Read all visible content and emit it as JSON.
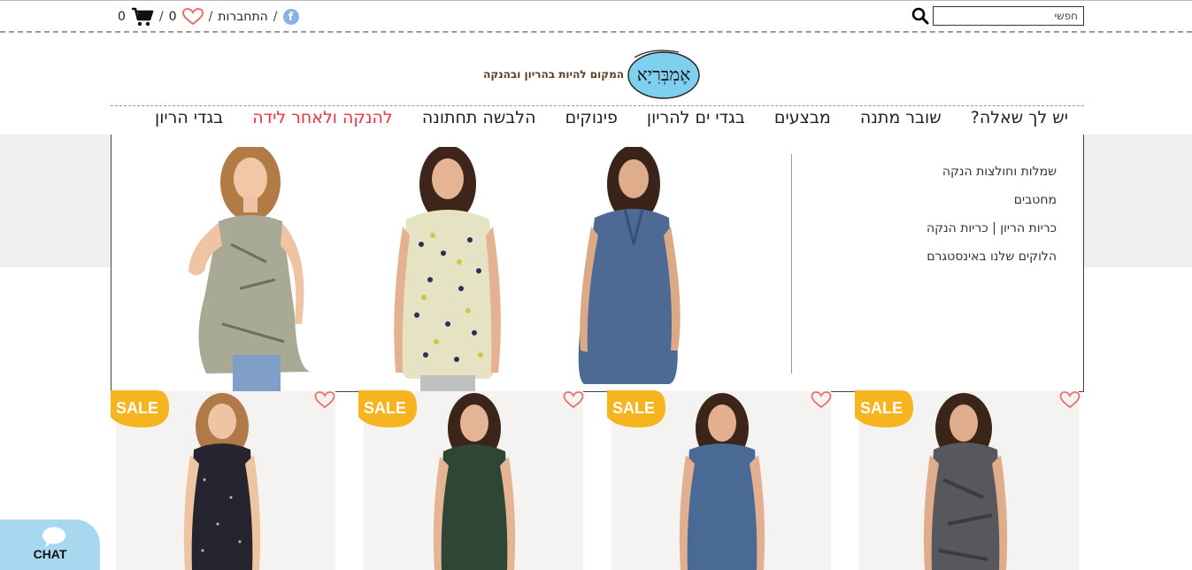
{
  "header": {
    "search_placeholder": "חפשי",
    "facebook_icon": "f",
    "login_label": "התחברות",
    "wishlist_count": "0",
    "cart_count": "0",
    "separator": "/"
  },
  "brand": {
    "logo_text": "אֶמְבְּרִיָא",
    "tagline": "המקום להיות בהריון ובהנקה",
    "logo_color": "#7fd0ee"
  },
  "nav": {
    "items": [
      {
        "label": "בגדי הריון",
        "active": false
      },
      {
        "label": "להנקה ולאחר לידה",
        "active": true
      },
      {
        "label": "הלבשה תחתונה",
        "active": false
      },
      {
        "label": "פינוקים",
        "active": false
      },
      {
        "label": "בגדי ים להריון",
        "active": false
      },
      {
        "label": "מבצעים",
        "active": false
      },
      {
        "label": "שובר מתנה",
        "active": false
      },
      {
        "label": "יש לך שאלה?",
        "active": false
      }
    ],
    "active_color": "#e8343f"
  },
  "dropdown": {
    "links": [
      "שמלות וחולצות הנקה",
      "מחטבים",
      "כריות הריון | כריות הנקה",
      "הלוקים שלנו באינסטגרם"
    ]
  },
  "products": {
    "sale_label": "SALE",
    "sale_color": "#f6b51e",
    "heart_color": "#e8706f"
  },
  "chat": {
    "label": "CHAT",
    "color": "#a8d8f0"
  }
}
